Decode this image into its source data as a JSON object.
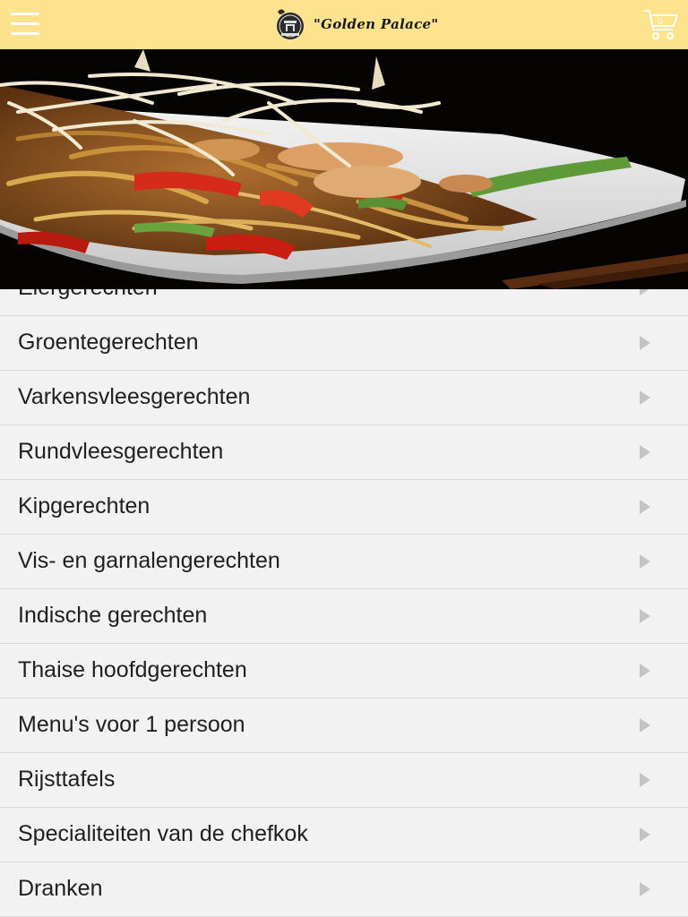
{
  "header": {
    "logo_text": "\"Golden Palace\"",
    "cart_count": "0",
    "colors": {
      "background": "#fde38e",
      "icons": "#ffffff"
    }
  },
  "menu": {
    "categories": [
      {
        "label": "Eiergerechten"
      },
      {
        "label": "Groentegerechten"
      },
      {
        "label": "Varkensvleesgerechten"
      },
      {
        "label": "Rundvleesgerechten"
      },
      {
        "label": "Kipgerechten"
      },
      {
        "label": "Vis- en garnalengerechten"
      },
      {
        "label": "Indische gerechten"
      },
      {
        "label": "Thaise hoofdgerechten"
      },
      {
        "label": "Menu's voor 1 persoon"
      },
      {
        "label": "Rijsttafels"
      },
      {
        "label": "Specialiteiten van de chefkok"
      },
      {
        "label": "Dranken"
      }
    ]
  }
}
